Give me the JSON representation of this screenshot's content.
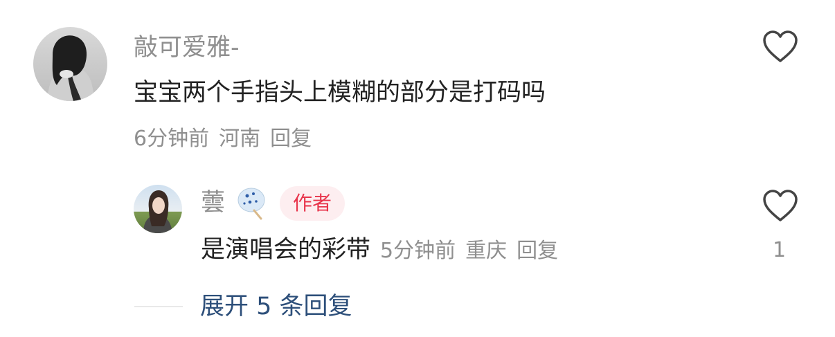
{
  "comment": {
    "username": "敲可爱雅-",
    "text": "宝宝两个手指头上模糊的部分是打码吗",
    "time": "6分钟前",
    "location": "河南",
    "reply_label": "回复",
    "like_icon": "heart-outline-icon"
  },
  "reply": {
    "username": "蕓",
    "badge": "作者",
    "text": "是演唱会的彩带",
    "time": "5分钟前",
    "location": "重庆",
    "reply_label": "回复",
    "like_icon": "heart-outline-icon",
    "like_count": "1"
  },
  "expand_label": "展开 5 条回复",
  "colors": {
    "username": "#8f8f8f",
    "text": "#222222",
    "badge_text": "#e8344b",
    "badge_bg": "#fdeef0",
    "link": "#2d4f7a"
  }
}
